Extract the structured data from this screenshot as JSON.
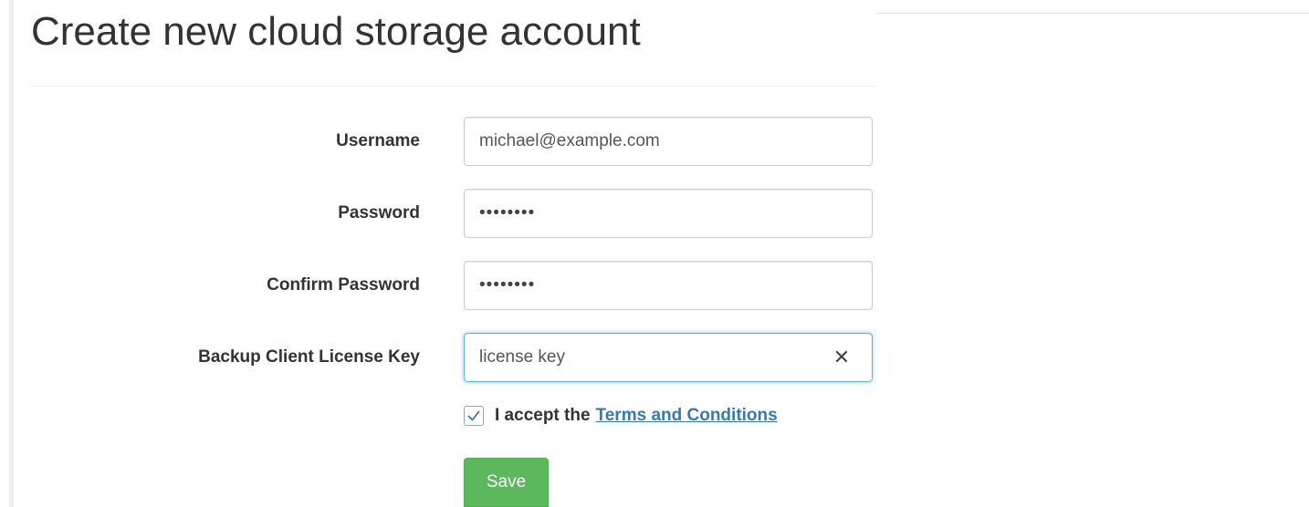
{
  "page": {
    "title": "Create new cloud storage account"
  },
  "form": {
    "username": {
      "label": "Username",
      "value": "michael@example.com"
    },
    "password": {
      "label": "Password",
      "value": "••••••••"
    },
    "confirm_password": {
      "label": "Confirm Password",
      "value": "••••••••"
    },
    "license_key": {
      "label": "Backup Client License Key",
      "value": "license key",
      "clear_icon": "close-icon"
    },
    "terms": {
      "checked": true,
      "text": "I accept the",
      "link_text": "Terms and Conditions"
    },
    "save_label": "Save"
  },
  "colors": {
    "primary_link": "#337ab7",
    "success_button": "#5cb85c",
    "focus_border": "#66afe9"
  }
}
